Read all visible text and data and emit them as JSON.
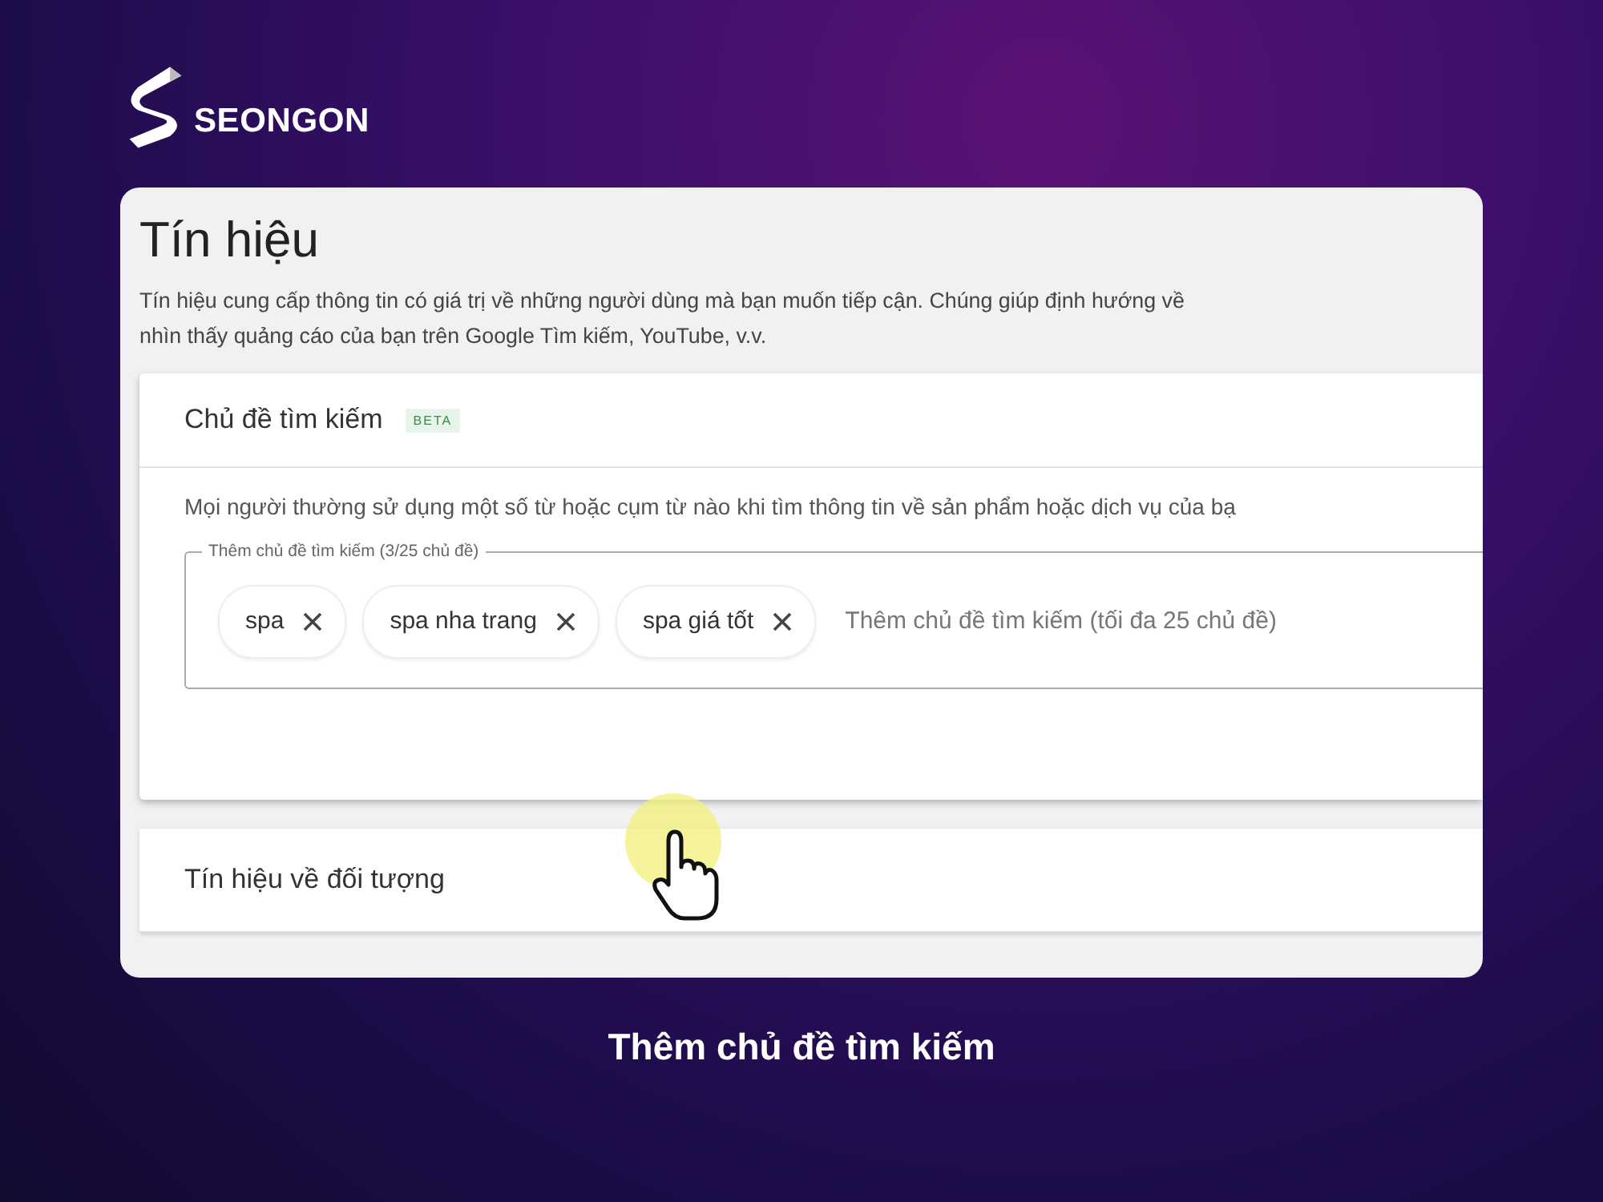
{
  "brand": {
    "name": "SEONGON"
  },
  "screen": {
    "title": "Tín hiệu",
    "description": "Tín hiệu cung cấp thông tin có giá trị về những người dùng mà bạn muốn tiếp cận. Chúng giúp định hướng về\nnhìn thấy quảng cáo của bạn trên Google Tìm kiếm, YouTube, v.v.",
    "search_topics": {
      "title": "Chủ đề tìm kiếm",
      "badge": "BETA",
      "description": "Mọi người thường sử dụng một số từ hoặc cụm từ nào khi tìm thông tin về sản phẩm hoặc dịch vụ của bạ",
      "field_label": "Thêm chủ đề tìm kiếm (3/25 chủ đề)",
      "chips": [
        {
          "label": "spa"
        },
        {
          "label": "spa nha trang"
        },
        {
          "label": "spa giá tốt"
        }
      ],
      "placeholder": "Thêm chủ đề tìm kiếm (tối đa 25 chủ đề)"
    },
    "audience_section": {
      "title": "Tín hiệu về đối tượng"
    }
  },
  "caption": "Thêm chủ đề tìm kiếm"
}
